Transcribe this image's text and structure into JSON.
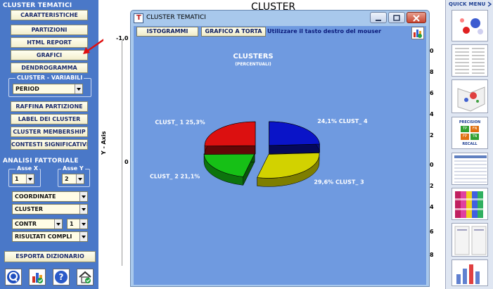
{
  "left_panel": {
    "section_cluster": "CLUSTER TEMATICI",
    "buttons": [
      "CARATTERISTICHE",
      "PARTIZIONI",
      "HTML REPORT",
      "GRAFICI",
      "DENDROGRAMMA"
    ],
    "group_variabili": "CLUSTER - VARIABILI",
    "period_select": "PERIOD",
    "buttons2": [
      "RAFFINA PARTIZIONE",
      "LABEL DEI CLUSTER",
      "CLUSTER MEMBERSHIP",
      "CONTESTI SIGNIFICATIVI"
    ],
    "section_fattoriale": "ANALISI FATTORIALE",
    "asse_x_label": "Asse X",
    "asse_y_label": "Asse Y",
    "asse_x_value": "1",
    "asse_y_value": "2",
    "coordinate_select": "COORDINATE",
    "cluster_select": "CLUSTER",
    "contr_select": "CONTR",
    "contr_num_select": "1",
    "risultati_select": "RISULTATI COMPLI",
    "esporta_button": "ESPORTA DIZIONARIO"
  },
  "background_chart": {
    "title": "CLUSTER",
    "y_axis_label": "Y - Axis",
    "left_ticks": [
      "-1,0",
      "0"
    ],
    "right_ticks": [
      "0",
      "8",
      "6",
      "4",
      "2",
      "0",
      "2",
      "4",
      "6",
      "8"
    ]
  },
  "quick_menu": {
    "title": "QUICK MENU",
    "precision_label": "PRECISION",
    "recall_label": "RECALL",
    "tp": "TP",
    "fn": "FN",
    "fp": "FP",
    "tn": "TN"
  },
  "dialog": {
    "title": "CLUSTER TEMATICI",
    "tab_istogrammi": "ISTOGRAMMI",
    "tab_torta": "GRAFICO A TORTA",
    "hint": "Utilizzare il tasto destro del mouser"
  },
  "chart_data": {
    "type": "pie",
    "title": "CLUSTERS",
    "subtitle": "(PERCENTUALI)",
    "slices": [
      {
        "label": "CLUST_ 4",
        "value": 24.1,
        "display": "24,1%",
        "color": "#0a14c8"
      },
      {
        "label": "CLUST_ 3",
        "value": 29.6,
        "display": "29,6%",
        "color": "#d2d200"
      },
      {
        "label": "CLUST_ 2",
        "value": 21.1,
        "display": "21,1%",
        "color": "#16c016"
      },
      {
        "label": "CLUST_ 1",
        "value": 25.3,
        "display": "25,3%",
        "color": "#dc1010"
      }
    ]
  }
}
